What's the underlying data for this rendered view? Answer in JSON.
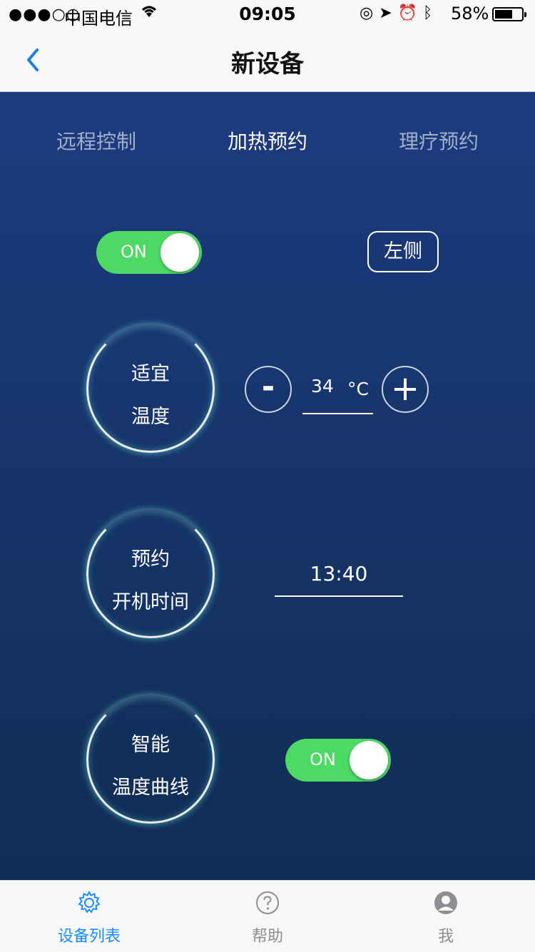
{
  "status_bar": {
    "signal": "●●●○○",
    "carrier": "中国电信",
    "time": "09:05",
    "battery_percent": "58%",
    "battery_level": 0.58
  },
  "nav": {
    "title": "新设备",
    "back_icon": "chevron-left-icon"
  },
  "tabs": [
    {
      "label": "远程控制",
      "active": false
    },
    {
      "label": "加热预约",
      "active": true
    },
    {
      "label": "理疗预约",
      "active": false
    }
  ],
  "power_toggle": {
    "label": "ON",
    "state": true
  },
  "side_button": {
    "label": "左侧"
  },
  "temperature": {
    "ring_line1": "适宜",
    "ring_line2": "温度",
    "minus_label": "-",
    "plus_label": "+",
    "value": "34",
    "unit": "°C"
  },
  "schedule": {
    "ring_line1": "预约",
    "ring_line2": "开机时间",
    "time": "13:40"
  },
  "smart_curve": {
    "ring_line1": "智能",
    "ring_line2": "温度曲线",
    "toggle_label": "ON",
    "state": true
  },
  "tab_bar": [
    {
      "label": "设备列表",
      "icon": "gear-icon",
      "active": true
    },
    {
      "label": "帮助",
      "icon": "help-icon",
      "active": false
    },
    {
      "label": "我",
      "icon": "user-icon",
      "active": false
    }
  ],
  "colors": {
    "accent": "#1a8cff",
    "toggle_on": "#4cd964",
    "background_top": "#1d3b80",
    "background_bottom": "#102d55"
  }
}
